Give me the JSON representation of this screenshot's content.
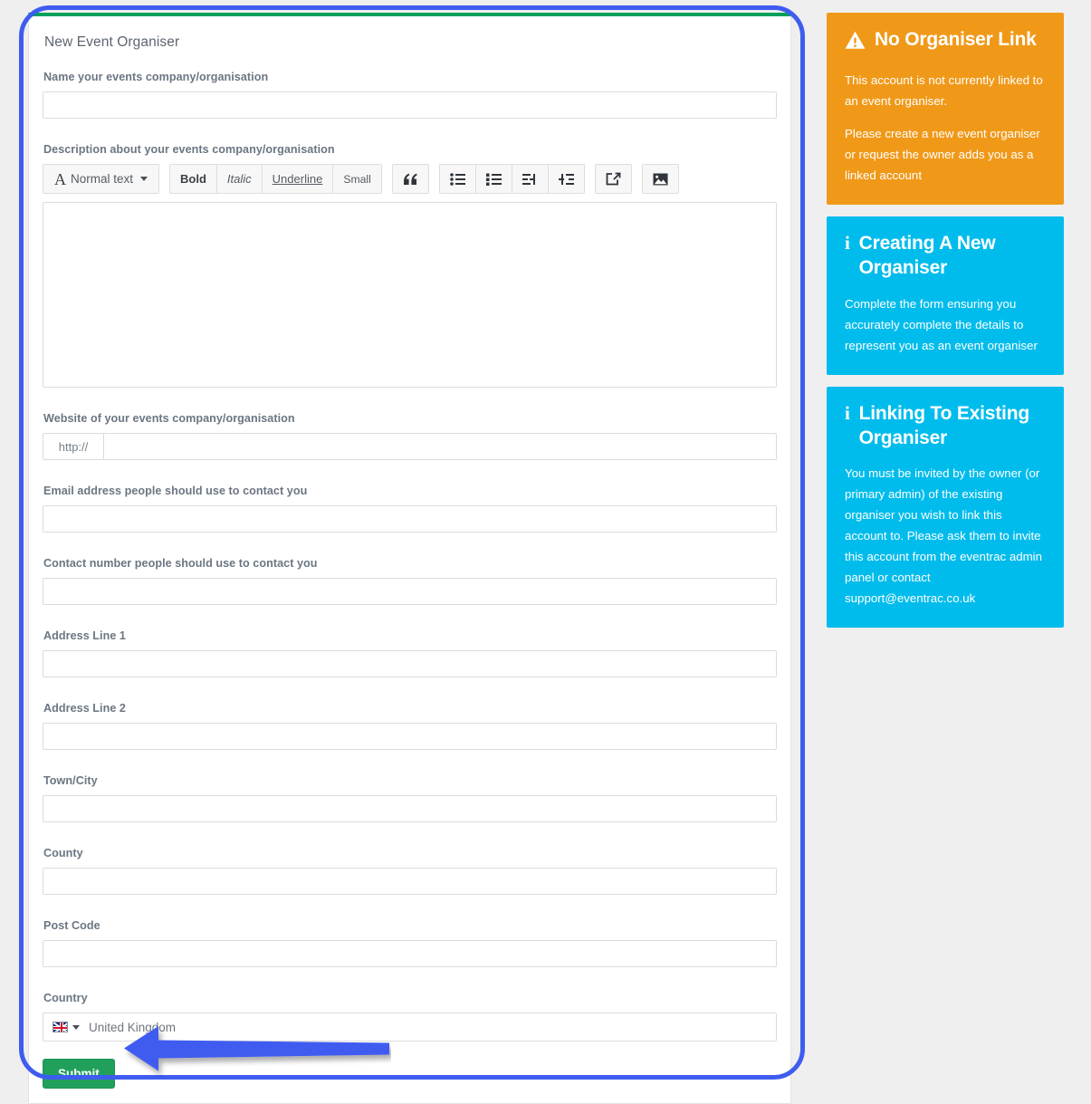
{
  "colors": {
    "page_background": "#efefef",
    "card_accent_top": "#00a05c",
    "warning_panel": "#f09919",
    "info_panel": "#00bcec",
    "submit_green": "#21a05b",
    "annotation_blue": "#3f5cf0"
  },
  "form": {
    "title": "New Event Organiser",
    "fields": {
      "name": {
        "label": "Name your events company/organisation",
        "value": "",
        "placeholder": ""
      },
      "description": {
        "label": "Description about your events company/organisation",
        "value": "",
        "placeholder": ""
      },
      "website": {
        "label": "Website of your events company/organisation",
        "addon": "http://",
        "value": "",
        "placeholder": ""
      },
      "email": {
        "label": "Email address people should use to contact you",
        "value": "",
        "placeholder": ""
      },
      "contact_number": {
        "label": "Contact number people should use to contact you",
        "value": "",
        "placeholder": ""
      },
      "address_line_1": {
        "label": "Address Line 1",
        "value": "",
        "placeholder": ""
      },
      "address_line_2": {
        "label": "Address Line 2",
        "value": "",
        "placeholder": ""
      },
      "town_city": {
        "label": "Town/City",
        "value": "",
        "placeholder": ""
      },
      "county": {
        "label": "County",
        "value": "",
        "placeholder": ""
      },
      "post_code": {
        "label": "Post Code",
        "value": "",
        "placeholder": ""
      },
      "country": {
        "label": "Country",
        "selected": "United Kingdom",
        "flag": "uk-flag-icon"
      }
    },
    "editor_toolbar": {
      "style_label": "Normal text",
      "style_glyph": "A",
      "bold": "Bold",
      "italic": "Italic",
      "underline": "Underline",
      "small": "Small",
      "quote_icon": "quote-icon",
      "bullet_list_icon": "bullet-list-icon",
      "numbered_list_icon": "numbered-list-icon",
      "indent_icon": "indent-icon",
      "outdent_icon": "outdent-icon",
      "link_icon": "link-icon",
      "image_icon": "image-icon"
    },
    "submit_label": "Submit"
  },
  "sidebar": {
    "panels": [
      {
        "type": "warning",
        "icon": "warning-triangle-icon",
        "title": "No Organiser Link",
        "paragraphs": [
          "This account is not currently linked to an event organiser.",
          "Please create a new event organiser or request the owner adds you as a linked account"
        ]
      },
      {
        "type": "info",
        "icon": "info-icon",
        "title": "Creating A New Organiser",
        "paragraphs": [
          "Complete the form ensuring you accurately complete the details to represent you as an event organiser"
        ]
      },
      {
        "type": "info",
        "icon": "info-icon",
        "title": "Linking To Existing Organiser",
        "paragraphs": [
          "You must be invited by the owner (or primary admin) of the existing organiser you wish to link this account to. Please ask them to invite this account from the eventrac admin panel or contact support@eventrac.co.uk"
        ]
      }
    ]
  },
  "annotations": {
    "highlight_rectangle": "blue-rounded-outline-around-form",
    "arrow": "blue-arrow-pointing-left-at-submit-button"
  }
}
